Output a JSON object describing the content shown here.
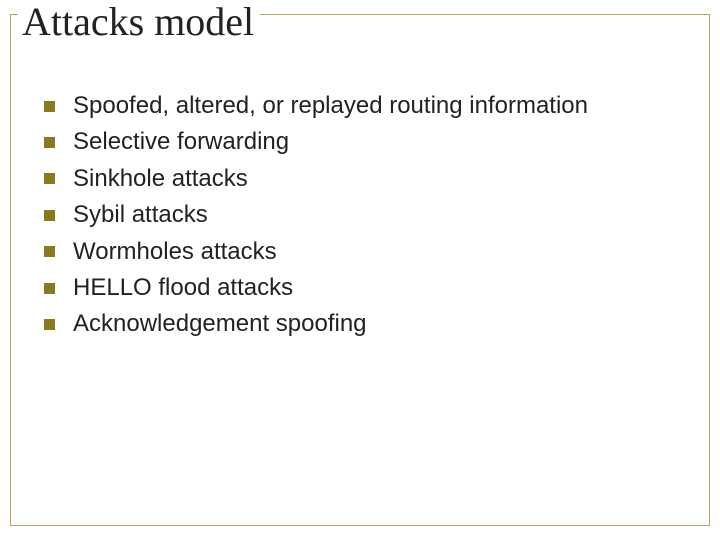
{
  "slide": {
    "title": "Attacks model",
    "bullets": [
      "Spoofed, altered, or replayed routing information",
      "Selective forwarding",
      "Sinkhole attacks",
      "Sybil attacks",
      "Wormholes attacks",
      "HELLO flood attacks",
      "Acknowledgement spoofing"
    ]
  },
  "colors": {
    "frame_border": "#b8a45a",
    "bullet_fill": "#8a7a1f",
    "text": "#222222",
    "background": "#ffffff"
  }
}
